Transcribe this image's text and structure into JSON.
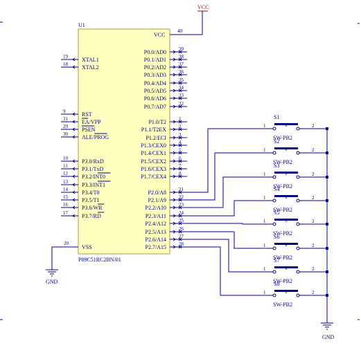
{
  "labels": {
    "vcc_top": "VCC",
    "gnd_left": "GND",
    "gnd_right": "GND"
  },
  "chip": {
    "designator": "U1",
    "part": "P89C51RC2BN/01",
    "vcc_pin_name": "VCC",
    "vcc_pin_num": "40",
    "vss_pin_name": "VSS",
    "vss_pin_num": "20"
  },
  "left_pins": [
    {
      "num": "19",
      "name": "XTAL1"
    },
    {
      "num": "18",
      "name": "XTAL2"
    },
    {
      "num": "9",
      "name": "RST"
    },
    {
      "num": "31",
      "name": "EA/VPP",
      "over": "EA"
    },
    {
      "num": "29",
      "name": "PSEN",
      "over": "PSEN"
    },
    {
      "num": "30",
      "name": "ALE/PROG",
      "over": "PROG"
    },
    {
      "num": "10",
      "name": "P3.0/RxD"
    },
    {
      "num": "11",
      "name": "P3.1/TxD"
    },
    {
      "num": "12",
      "name": "P3.2/INT0",
      "over": "INT0"
    },
    {
      "num": "13",
      "name": "P3.3/INT1",
      "over": "INT1"
    },
    {
      "num": "14",
      "name": "P3.4/T0"
    },
    {
      "num": "15",
      "name": "P3.5/T1"
    },
    {
      "num": "16",
      "name": "P3.6/WR",
      "over": "WR"
    },
    {
      "num": "17",
      "name": "P3.7/RD",
      "over": "RD"
    }
  ],
  "right_pins": [
    {
      "num": "39",
      "name": "P0.0/AD0"
    },
    {
      "num": "38",
      "name": "P0.1/AD1"
    },
    {
      "num": "37",
      "name": "P0.2/AD2"
    },
    {
      "num": "36",
      "name": "P0.3/AD3"
    },
    {
      "num": "35",
      "name": "P0.4/AD4"
    },
    {
      "num": "34",
      "name": "P0.5/AD5"
    },
    {
      "num": "33",
      "name": "P0.6/AD6"
    },
    {
      "num": "32",
      "name": "P0.7/AD7"
    },
    {
      "num": "1",
      "name": "P1.0/T2"
    },
    {
      "num": "2",
      "name": "P1.1/T2EX"
    },
    {
      "num": "3",
      "name": "P1.2/ECI"
    },
    {
      "num": "4",
      "name": "P1.3/CEX0"
    },
    {
      "num": "5",
      "name": "P1.4/CEX1"
    },
    {
      "num": "6",
      "name": "P1.5/CEX2"
    },
    {
      "num": "7",
      "name": "P1.6/CEX3"
    },
    {
      "num": "8",
      "name": "P1.7/CEX4"
    },
    {
      "num": "21",
      "name": "P2.0/A8"
    },
    {
      "num": "22",
      "name": "P2.1/A9"
    },
    {
      "num": "23",
      "name": "P2.2/A10"
    },
    {
      "num": "24",
      "name": "P2.3/A11"
    },
    {
      "num": "25",
      "name": "P2.4/A12"
    },
    {
      "num": "26",
      "name": "P2.5/A13"
    },
    {
      "num": "27",
      "name": "P2.6/A14"
    },
    {
      "num": "28",
      "name": "P2.7/A15"
    }
  ],
  "switches": [
    {
      "ref": "S1",
      "type": "SW-PB2",
      "pin1": "1",
      "pin2": "2"
    },
    {
      "ref": "S2",
      "type": "SW-PB2",
      "pin1": "1",
      "pin2": "2"
    },
    {
      "ref": "S3",
      "type": "SW-PB2",
      "pin1": "1",
      "pin2": "2"
    },
    {
      "ref": "S4",
      "type": "SW-PB2",
      "pin1": "1",
      "pin2": "2"
    },
    {
      "ref": "S5",
      "type": "SW-PB2",
      "pin1": "1",
      "pin2": "2"
    },
    {
      "ref": "S6",
      "type": "SW-PB2",
      "pin1": "1",
      "pin2": "2"
    },
    {
      "ref": "S7",
      "type": "SW-PB2",
      "pin1": "1",
      "pin2": "2"
    },
    {
      "ref": "S8",
      "type": "SW-PB2",
      "pin1": "1",
      "pin2": "2"
    }
  ]
}
